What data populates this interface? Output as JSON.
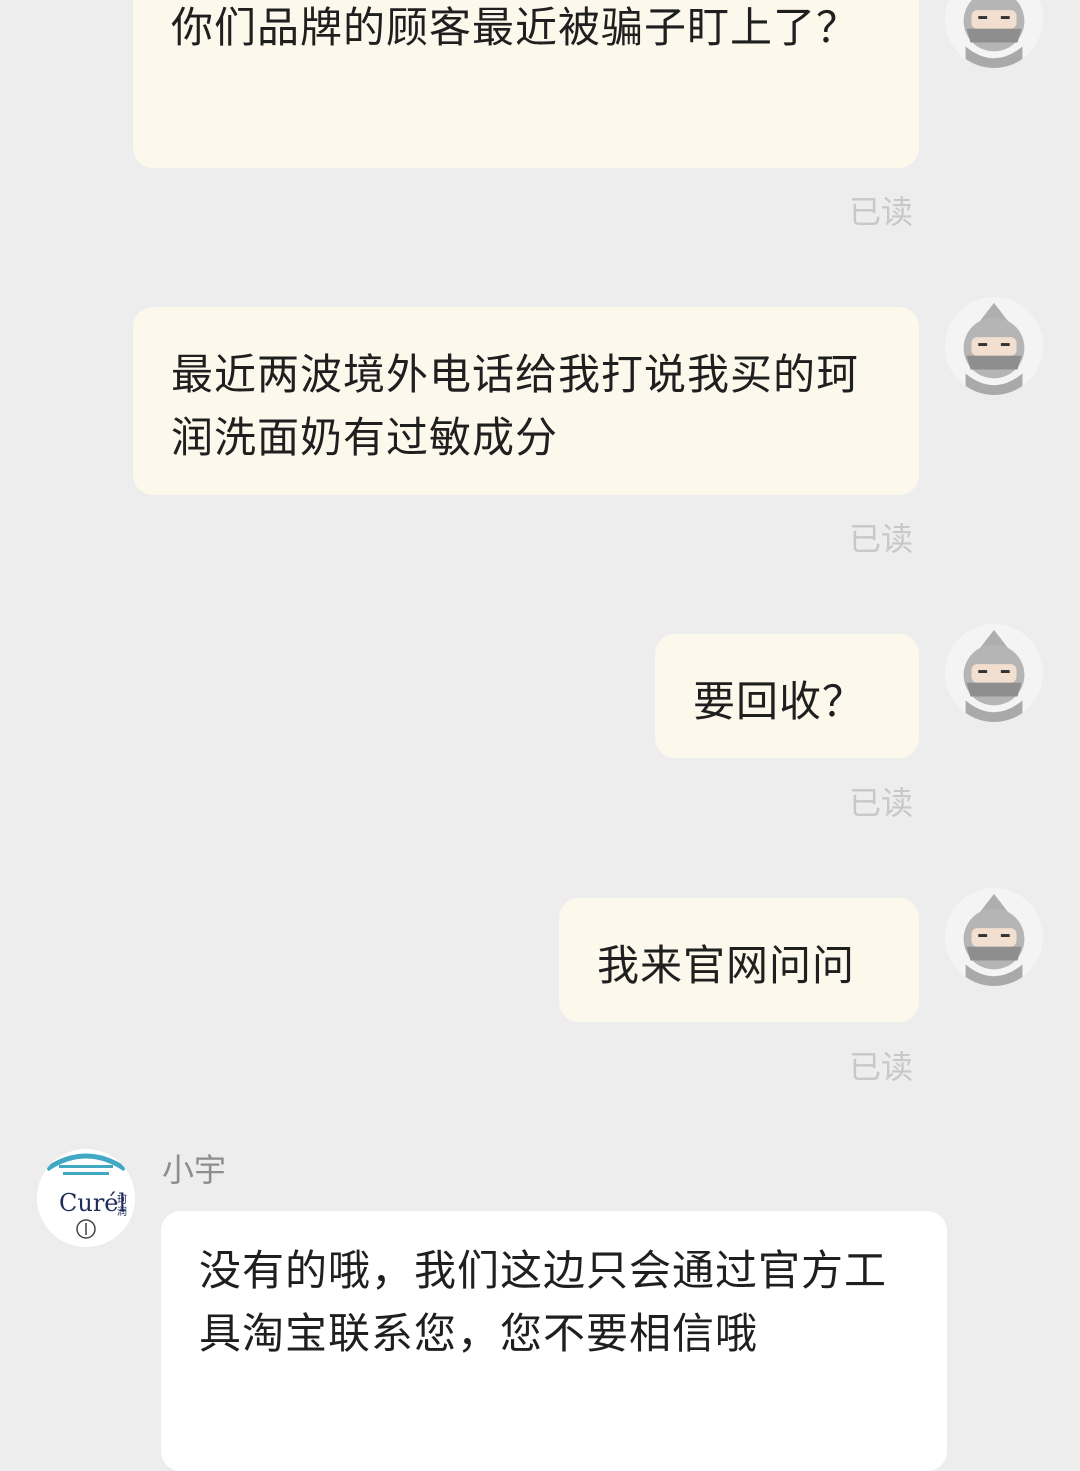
{
  "conversation": {
    "sent": [
      {
        "text": "你们品牌的顾客最近被骗子盯上了？",
        "status": "已读"
      },
      {
        "text": "最近两波境外电话给我打说我买的珂润洗面奶有过敏成分",
        "status": "已读"
      },
      {
        "text": "要回收？",
        "status": "已读"
      },
      {
        "text": "我来官网问问",
        "status": "已读"
      }
    ],
    "received": [
      {
        "sender": "小宇",
        "text": "没有的哦，我们这边只会通过官方工具淘宝联系您，您不要相信哦",
        "avatar_brand": "Curél",
        "avatar_brand_cn": "珂润"
      }
    ]
  },
  "theme": {
    "background": "#ededed",
    "sent_bubble": "#fcf8ec",
    "received_bubble": "#ffffff",
    "read_status": "#c8c8c8",
    "brand_teal": "#41a8c4"
  },
  "icons": {
    "user_avatar": "ninja-avatar-icon",
    "brand_avatar": "curel-logo-icon"
  }
}
